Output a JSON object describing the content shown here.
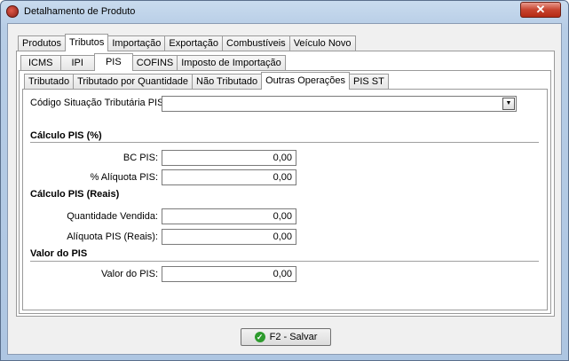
{
  "window": {
    "title": "Detalhamento de Produto",
    "close_glyph": "✕"
  },
  "tabs_main": [
    "Produtos",
    "Tributos",
    "Importação",
    "Exportação",
    "Combustíveis",
    "Veículo Novo"
  ],
  "tabs_tributos": [
    "ICMS",
    "IPI",
    "PIS",
    "COFINS",
    "Imposto de Importação"
  ],
  "tabs_pis": [
    "Tributado",
    "Tributado por Quantidade",
    "Não Tributado",
    "Outras Operações",
    "PIS ST"
  ],
  "form": {
    "cst_label": "Código Situação Tributária PIS:",
    "cst_value": "",
    "section_percent": "Cálculo PIS (%)",
    "bc_label": "BC PIS:",
    "bc_value": "0,00",
    "aliq_label": "% Alíquota PIS:",
    "aliq_value": "0,00",
    "section_reais": "Cálculo PIS (Reais)",
    "qtd_label": "Quantidade Vendida:",
    "qtd_value": "0,00",
    "aliq_reais_label": "Alíquota PIS (Reais):",
    "aliq_reais_value": "0,00",
    "section_valor": "Valor do PIS",
    "valor_label": "Valor do PIS:",
    "valor_value": "0,00"
  },
  "footer": {
    "save_label": "F2 - Salvar",
    "save_icon": "check-icon"
  }
}
